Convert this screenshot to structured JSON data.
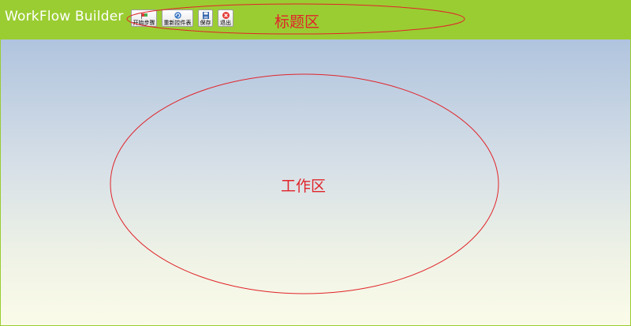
{
  "header": {
    "app_title": "WorkFlow Builder",
    "background_color": "#9acd32"
  },
  "toolbar": {
    "buttons": [
      {
        "id": "start",
        "label": "开始步骤",
        "icon": "flag-icon"
      },
      {
        "id": "refresh",
        "label": "重新控件表",
        "icon": "refresh-icon"
      },
      {
        "id": "save",
        "label": "保存",
        "icon": "floppy-disk-icon"
      },
      {
        "id": "exit",
        "label": "退出",
        "icon": "close-circle-icon"
      }
    ]
  },
  "annotations": {
    "header_area_label": "标题区",
    "workspace_area_label": "工作区",
    "color": "#e0242a"
  },
  "workspace": {
    "gradient_top": "#b0c4de",
    "gradient_bottom": "#fbfbe8"
  }
}
